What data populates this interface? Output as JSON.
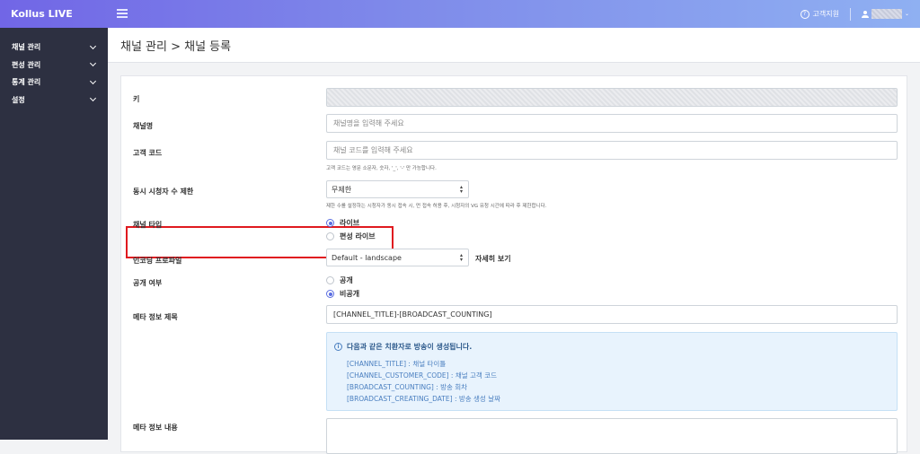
{
  "header": {
    "brand": "Kollus LIVE",
    "help_label": "고객지원",
    "help_icon": "question-circle-icon",
    "user_caret": "⌄"
  },
  "sidebar": {
    "items": [
      {
        "label": "채널 관리"
      },
      {
        "label": "편성 관리"
      },
      {
        "label": "통계 관리"
      },
      {
        "label": "설정"
      }
    ]
  },
  "page": {
    "title": "채널 관리 > 채널 등록"
  },
  "form": {
    "key": {
      "label": "키",
      "value": ""
    },
    "channel_name": {
      "label": "채널명",
      "placeholder": "채널명을 입력해 주세요"
    },
    "customer_code": {
      "label": "고객 코드",
      "placeholder": "채널 코드를 입력해 주세요",
      "hint": "고객 코드는 영문 소문자, 숫자, '_', '-' 만 가능합니다."
    },
    "viewer_limit": {
      "label": "동시 시청자 수 제한",
      "selected": "무제한",
      "hint": "제한 수를 설정하는 시청자가 동시 접속 시, 먼 접속 허용 후, 시청자의 VG 유청 시간에 따라 후 제한합니다."
    },
    "channel_type": {
      "label": "채널 타입",
      "options": [
        {
          "label": "라이브",
          "checked": true
        },
        {
          "label": "편성 라이브",
          "checked": false
        }
      ]
    },
    "encoding_profile": {
      "label": "인코딩 프로파일",
      "selected": "Default - landscape",
      "detail_link": "자세히 보기"
    },
    "visibility": {
      "label": "공개 여부",
      "options": [
        {
          "label": "공개",
          "checked": false
        },
        {
          "label": "비공개",
          "checked": true
        }
      ]
    },
    "meta_title": {
      "label": "메타 정보 제목",
      "value": "[CHANNEL_TITLE]-[BROADCAST_COUNTING]"
    },
    "info": {
      "title": "다음과 같은 치환자로 방송이 생성됩니다.",
      "lines": [
        "[CHANNEL_TITLE] : 채널 타이틀",
        "[CHANNEL_CUSTOMER_CODE] : 채널 고객 코드",
        "[BROADCAST_COUNTING] : 방송 회차",
        "[BROADCAST_CREATING_DATE] : 방송 생성 날짜"
      ]
    },
    "meta_content": {
      "label": "메타 정보 내용"
    }
  },
  "colors": {
    "accent": "#5b6ee1",
    "highlight": "#e0191f",
    "sidebar_bg": "#2d3041"
  }
}
